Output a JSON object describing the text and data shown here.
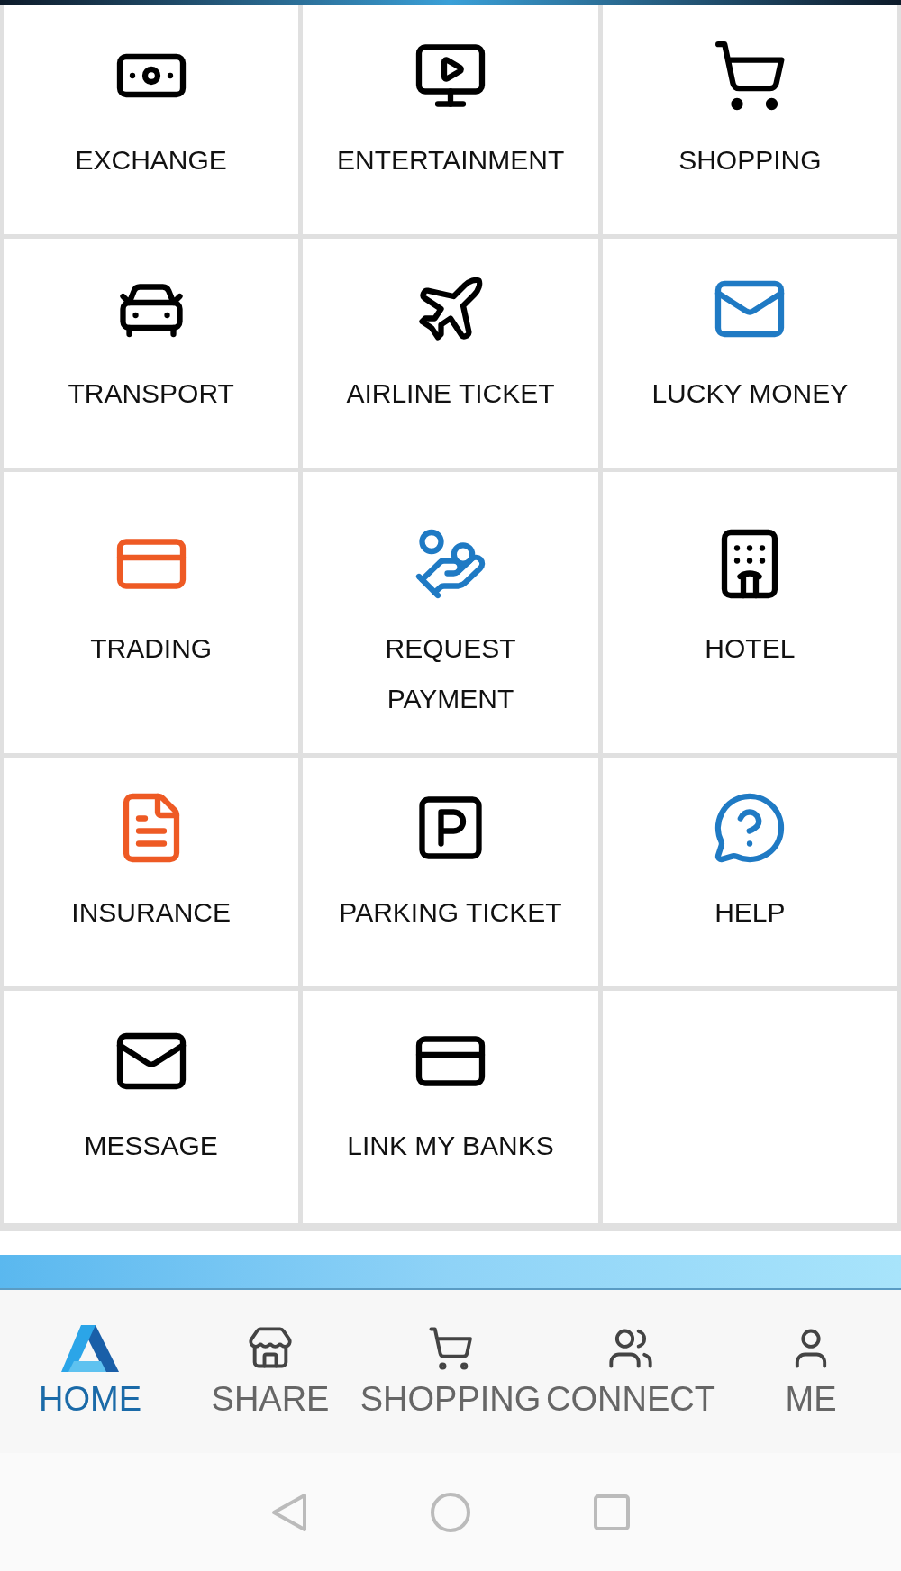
{
  "tiles": [
    {
      "kind": "exchange",
      "label": "EXCHANGE"
    },
    {
      "kind": "entertainment",
      "label": "ENTERTAINMENT"
    },
    {
      "kind": "shopping",
      "label": "SHOPPING"
    },
    {
      "kind": "transport",
      "label": "TRANSPORT"
    },
    {
      "kind": "airline",
      "label": "AIRLINE TICKET"
    },
    {
      "kind": "envelope",
      "label": "LUCKY MONEY"
    },
    {
      "kind": "trading",
      "label": "TRADING"
    },
    {
      "kind": "request",
      "label": "REQUEST PAYMENT"
    },
    {
      "kind": "hotel",
      "label": "HOTEL"
    },
    {
      "kind": "insurance",
      "label": "INSURANCE"
    },
    {
      "kind": "parking",
      "label": "PARKING TICKET"
    },
    {
      "kind": "help",
      "label": "HELP"
    },
    {
      "kind": "message",
      "label": "MESSAGE"
    },
    {
      "kind": "banks",
      "label": "LINK MY BANKS"
    }
  ],
  "bottom_nav": [
    {
      "kind": "home",
      "label": "HOME",
      "selected": true
    },
    {
      "kind": "share",
      "label": "SHARE",
      "selected": false
    },
    {
      "kind": "shopping",
      "label": "SHOPPING",
      "selected": false
    },
    {
      "kind": "connect",
      "label": "CONNECT",
      "selected": false
    },
    {
      "kind": "me",
      "label": "ME",
      "selected": false
    }
  ]
}
